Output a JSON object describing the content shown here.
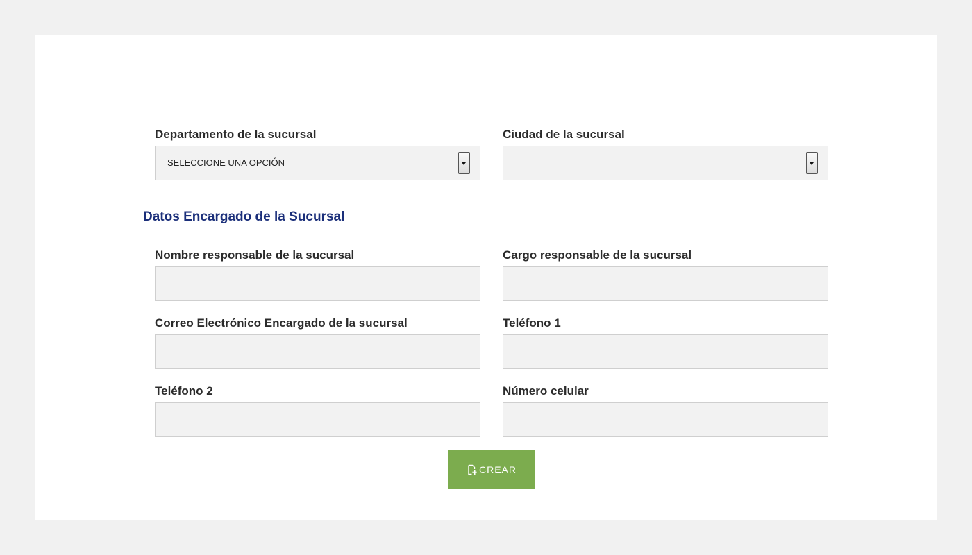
{
  "location": {
    "department": {
      "label": "Departamento de la sucursal",
      "selected": "SELECCIONE UNA OPCIÓN"
    },
    "city": {
      "label": "Ciudad de la sucursal",
      "selected": ""
    }
  },
  "manager_section": {
    "title": "Datos Encargado de la Sucursal",
    "fields": {
      "name": {
        "label": "Nombre responsable de la sucursal",
        "value": ""
      },
      "position": {
        "label": "Cargo responsable de la sucursal",
        "value": ""
      },
      "email": {
        "label": "Correo Electrónico Encargado de la sucursal",
        "value": ""
      },
      "phone1": {
        "label": "Teléfono 1",
        "value": ""
      },
      "phone2": {
        "label": "Teléfono 2",
        "value": ""
      },
      "mobile": {
        "label": "Número celular",
        "value": ""
      }
    }
  },
  "actions": {
    "create_label": "CREAR",
    "create_icon": "file-plus-icon"
  },
  "colors": {
    "page_bg": "#f1f1f1",
    "card_bg": "#ffffff",
    "section_title": "#1b2f7a",
    "button": "#7cac4e",
    "field_bg": "#f2f2f2"
  }
}
